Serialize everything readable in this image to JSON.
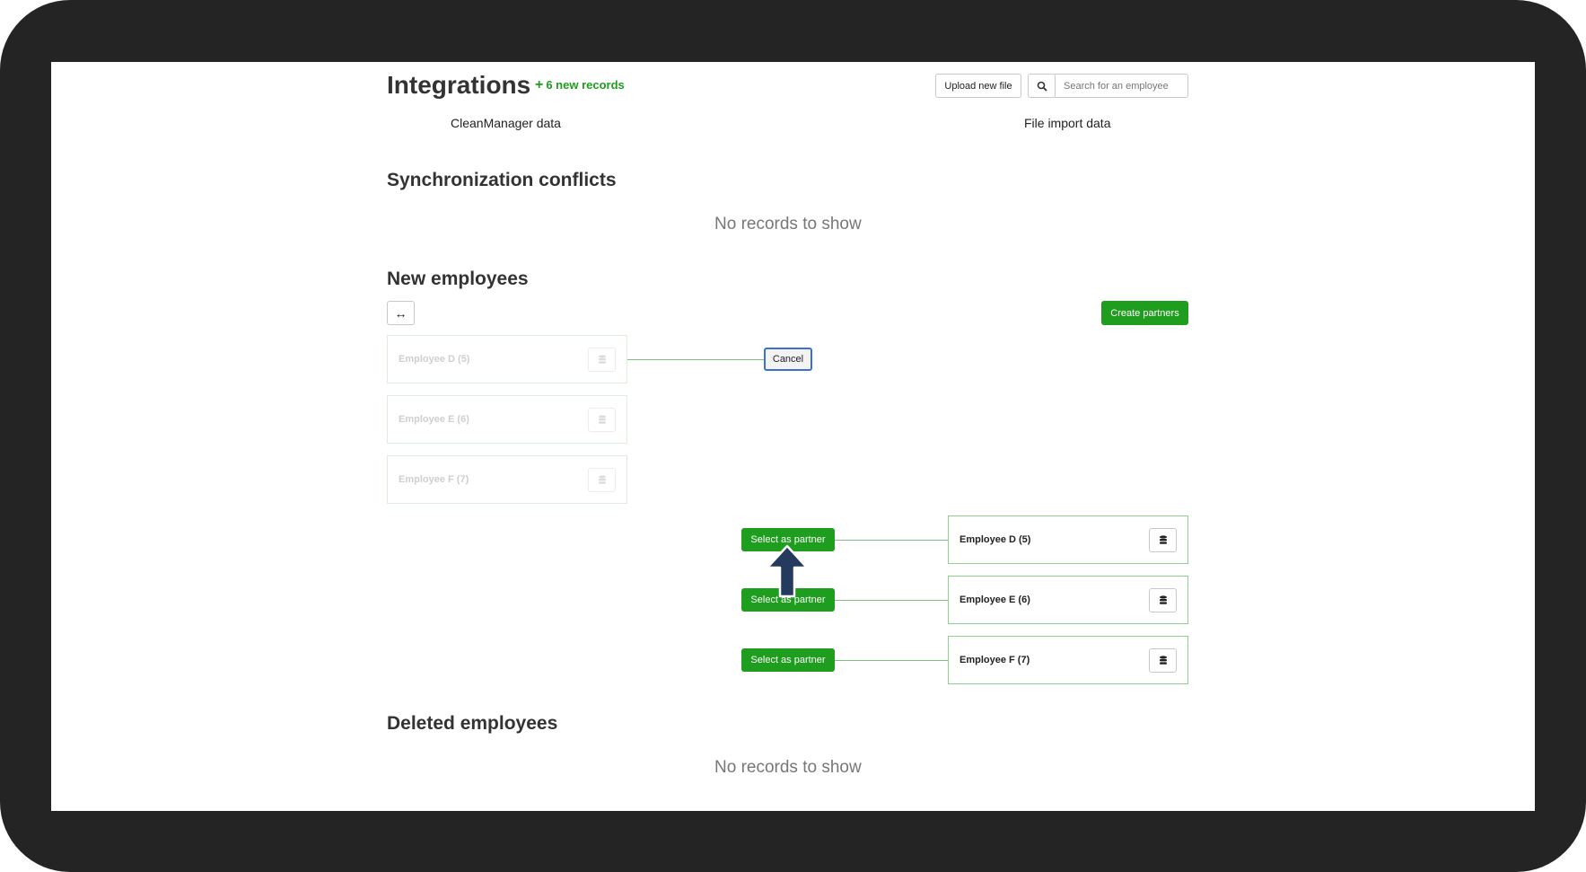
{
  "header": {
    "title": "Integrations",
    "new_records": "6 new records",
    "upload_label": "Upload new file",
    "search_placeholder": "Search for an employee"
  },
  "columns": {
    "left": "CleanManager data",
    "right": "File import data"
  },
  "sync_conflicts": {
    "title": "Synchronization conflicts",
    "empty_text": "No records to show"
  },
  "new_employees": {
    "title": "New employees",
    "swap_icon": "↔",
    "create_label": "Create partners",
    "cancel_label": "Cancel",
    "left_cards": [
      "Employee D (5)",
      "Employee E (6)",
      "Employee F (7)"
    ],
    "right_cards": [
      "Employee D (5)",
      "Employee E (6)",
      "Employee F (7)"
    ],
    "partner_label": "Select as partner"
  },
  "deleted_employees": {
    "title": "Deleted employees",
    "empty_text": "No records to show"
  },
  "colors": {
    "accent_green": "#1f9d1f",
    "focus_blue": "#3b6fd8",
    "arrow": "#243b5e",
    "frame": "#242424"
  },
  "icons": [
    "search-icon",
    "swap-icon",
    "database-icon",
    "plus-icon",
    "arrow-up-icon"
  ]
}
